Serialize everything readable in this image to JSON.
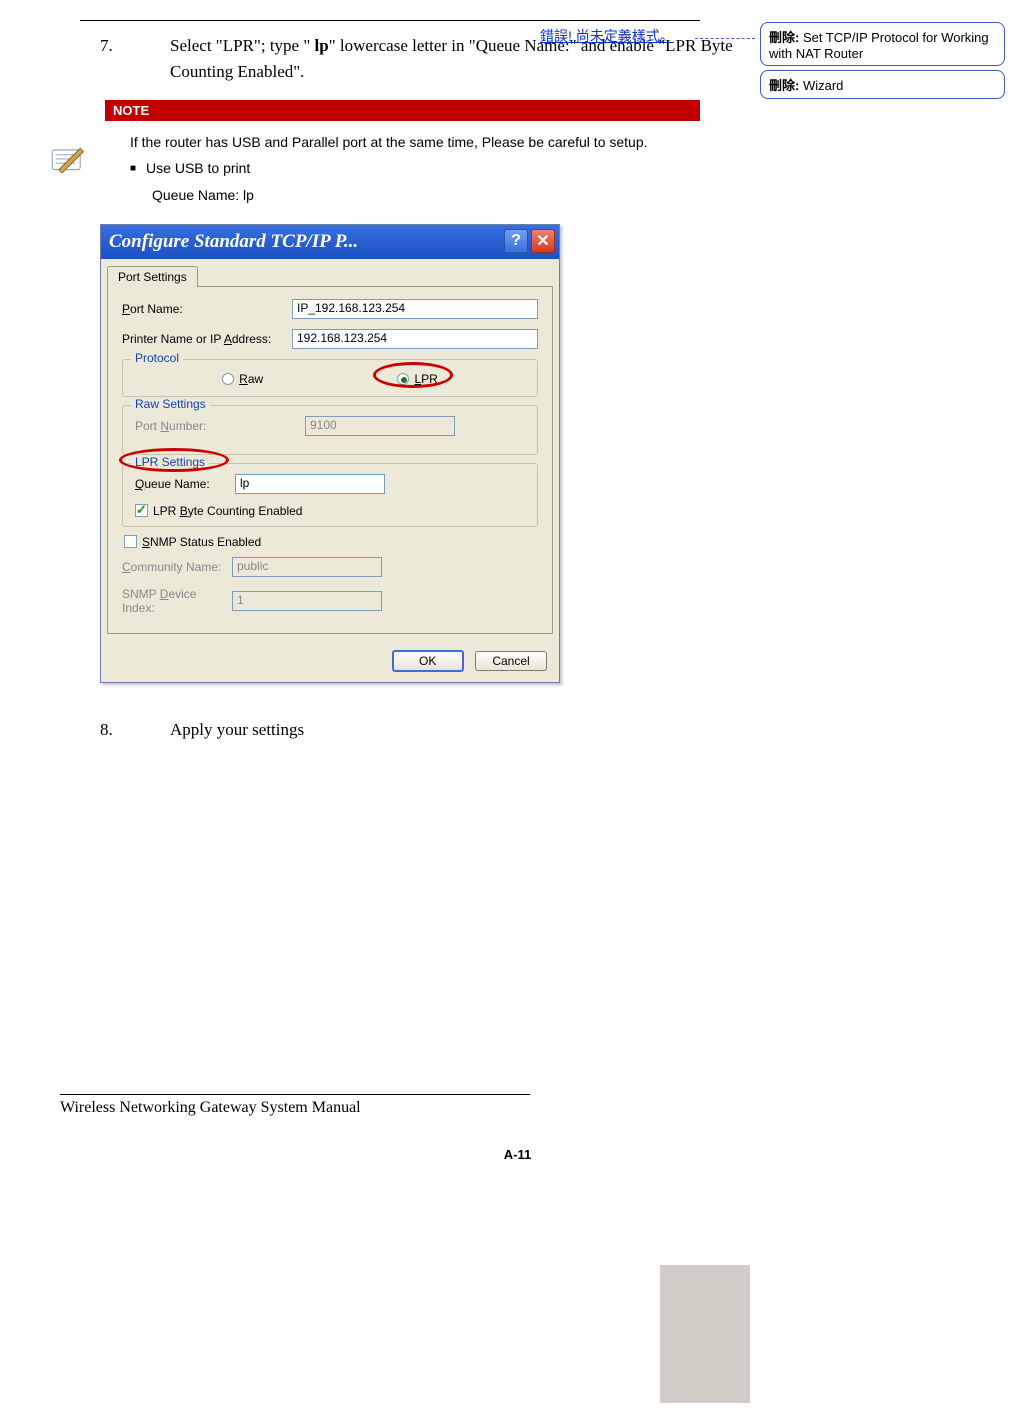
{
  "header": {
    "error_text": "錯誤! 尚未定義樣式。"
  },
  "balloons": [
    {
      "label": "刪除:",
      "text": " Set TCP/IP Protocol for Working with NAT Router"
    },
    {
      "label": "刪除:",
      "text": " Wizard"
    }
  ],
  "steps": {
    "seven": {
      "num": "7.",
      "pre": "Select \"LPR\"; type \" ",
      "bold": "lp",
      "post": "\" lowercase letter in \"Queue Name:\" and enable \"LPR Byte Counting Enabled\"."
    },
    "eight": {
      "num": "8.",
      "text": "Apply your settings"
    }
  },
  "note": {
    "head": "NOTE",
    "line1": "If the router has USB and Parallel port at the same time, Please be careful to setup.",
    "bullet": "Use USB to print",
    "sub": "Queue Name: lp"
  },
  "dialog": {
    "title": "Configure Standard TCP/IP P...",
    "tab": "Port Settings",
    "portname_label": "Port Name:",
    "portname_value": "IP_192.168.123.254",
    "printer_label": "Printer Name or IP Address:",
    "printer_value": "192.168.123.254",
    "protocol_legend": "Protocol",
    "raw_label": "Raw",
    "lpr_label": "LPR",
    "raw_legend": "Raw Settings",
    "portnum_label": "Port Number:",
    "portnum_value": "9100",
    "lpr_legend": "LPR Settings",
    "queue_label": "Queue Name:",
    "queue_value": "lp",
    "lpr_chk": "LPR Byte Counting Enabled",
    "snmp_chk": "SNMP Status Enabled",
    "comm_label": "Community Name:",
    "comm_value": "public",
    "snmpidx_label": "SNMP Device Index:",
    "snmpidx_value": "1",
    "ok": "OK",
    "cancel": "Cancel"
  },
  "footer": {
    "title": "Wireless Networking Gateway System Manual",
    "page": "A-11"
  }
}
